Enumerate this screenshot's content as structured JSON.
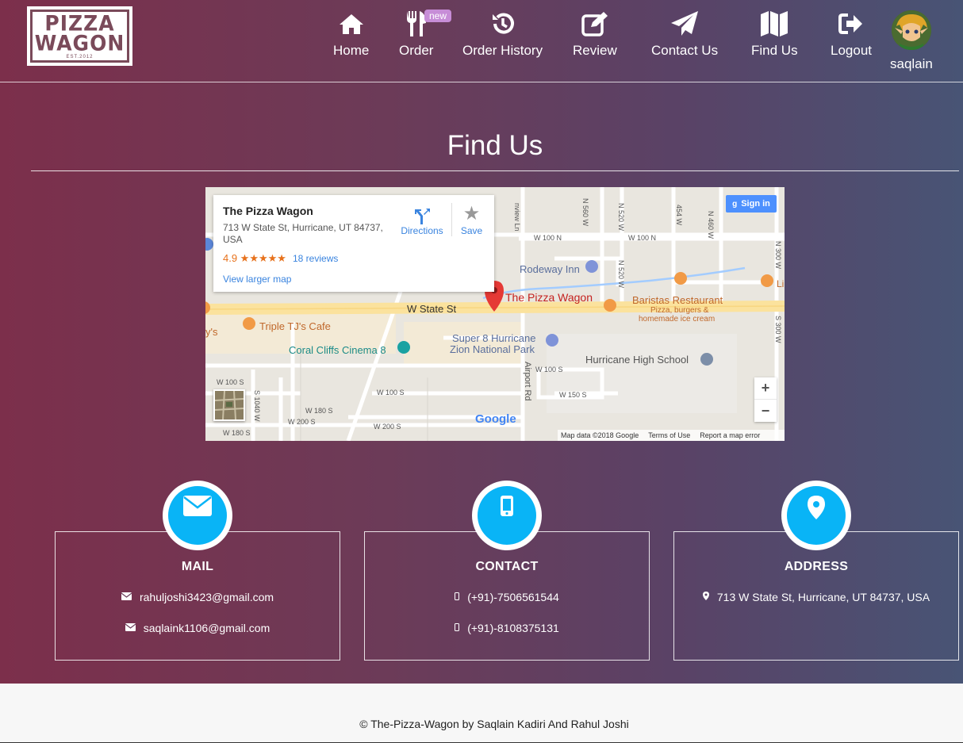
{
  "brand": {
    "line1": "PIZZA",
    "line2": "WAGON",
    "est": "EST.2012"
  },
  "nav": [
    {
      "label": "Home",
      "icon": "home-icon"
    },
    {
      "label": "Order",
      "icon": "utensils-icon",
      "badge": "new"
    },
    {
      "label": "Order History",
      "icon": "history-icon"
    },
    {
      "label": "Review",
      "icon": "edit-icon"
    },
    {
      "label": "Contact Us",
      "icon": "paper-plane-icon"
    },
    {
      "label": "Find Us",
      "icon": "map-icon"
    },
    {
      "label": "Logout",
      "icon": "sign-out-icon"
    }
  ],
  "user": {
    "name": "saqlain"
  },
  "page": {
    "title": "Find Us"
  },
  "map": {
    "place_name": "The Pizza Wagon",
    "address": "713 W State St, Hurricane, UT 84737, USA",
    "rating": "4.9 ★★★★★",
    "reviews": "18 reviews",
    "directions": "Directions",
    "save": "Save",
    "larger_map": "View larger map",
    "sign_in": "Sign in",
    "zoom_in": "+",
    "zoom_out": "−",
    "google": "Google",
    "attribution": {
      "data": "Map data ©2018 Google",
      "terms": "Terms of Use",
      "report": "Report a map error"
    },
    "labels": {
      "w_state_st": "W State St",
      "pin": "The Pizza Wagon",
      "baristas": "Baristas Restaurant",
      "baristas_sub1": "Pizza, burgers &",
      "baristas_sub2": "homemade ice cream",
      "rodeway": "Rodeway Inn",
      "triple": "Triple TJ's Cafe",
      "ys": "y's",
      "coral": "Coral Cliffs Cinema 8",
      "super8a": "Super 8 Hurricane",
      "super8b": "Zion National Park",
      "school": "Hurricane High School",
      "airport": "Airport Rd",
      "w100n_a": "W 100 N",
      "w100n_b": "W 100 N",
      "n560w": "N 560 W",
      "n520w_a": "N 520 W",
      "n520w_b": "N 520 W",
      "n454w": "454 W",
      "n460w": "N 460 W",
      "n300w": "N 300 W",
      "s300w": "S 300 W",
      "w100s_a": "W 100 S",
      "w100s_b": "W 100 S",
      "w100s_c": "W 100 S",
      "w150s": "W 150 S",
      "w180s_a": "W 180 S",
      "w180s_b": "W 180 S",
      "w200s_a": "W 200 S",
      "w200s_b": "W 200 S",
      "s1040w": "S 1040 W",
      "view_ln": "nview Ln",
      "li": "Li"
    }
  },
  "cards": {
    "mail": {
      "title": "MAIL",
      "line1": "rahuljoshi3423@gmail.com",
      "line2": "saqlaink1106@gmail.com"
    },
    "contact": {
      "title": "CONTACT",
      "line1": "(+91)-7506561544",
      "line2": "(+91)-8108375131"
    },
    "address": {
      "title": "ADDRESS",
      "line1": "713 W State St, Hurricane, UT 84737, USA"
    }
  },
  "footer": {
    "text": "© The-Pizza-Wagon by Saqlain Kadiri And Rahul Joshi"
  },
  "colors": {
    "accent": "#09b4f6",
    "gradient_start": "#7c2f4b",
    "gradient_end": "#485475",
    "link": "#3a84df",
    "rating": "#e7711b"
  }
}
